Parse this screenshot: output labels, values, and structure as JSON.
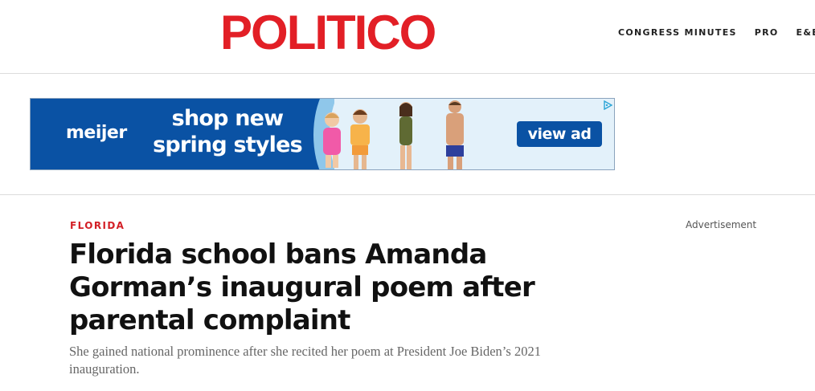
{
  "header": {
    "logo": "POLITICO",
    "nav": [
      "CONGRESS MINUTES",
      "PRO",
      "E&E N"
    ]
  },
  "ad": {
    "brand": "meijer",
    "headline_line1": "shop new",
    "headline_line2": "spring styles",
    "cta": "view ad",
    "colors": {
      "brand_blue": "#0a52a4",
      "light": "#e3f1fa"
    }
  },
  "article": {
    "kicker": "FLORIDA",
    "title": "Florida school bans Amanda Gorman’s inaugural poem after parental complaint",
    "dek": "She gained national prominence after she recited her poem at President Joe Biden’s 2021 inauguration.",
    "advertisement_label": "Advertisement"
  },
  "colors": {
    "accent": "#e21f26",
    "kicker": "#d31f26"
  },
  "icons": [
    "adchoices-icon"
  ]
}
